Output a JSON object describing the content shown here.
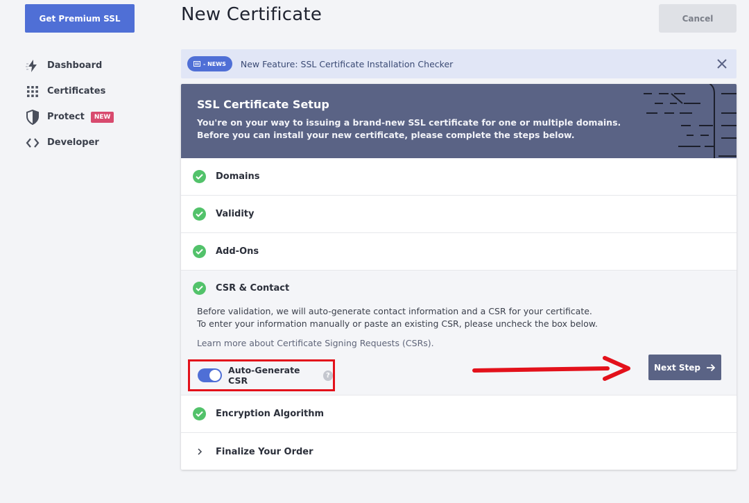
{
  "sidebar": {
    "premium_button": "Get Premium SSL",
    "items": [
      {
        "label": "Dashboard",
        "icon": "bolt-icon"
      },
      {
        "label": "Certificates",
        "icon": "grid-icon"
      },
      {
        "label": "Protect",
        "icon": "shield-icon",
        "badge": "NEW"
      },
      {
        "label": "Developer",
        "icon": "code-icon"
      }
    ]
  },
  "header": {
    "title": "New Certificate",
    "cancel_label": "Cancel"
  },
  "news": {
    "pill": "- NEWS",
    "text": "New Feature: SSL Certificate Installation Checker"
  },
  "setup": {
    "title": "SSL Certificate Setup",
    "line1": "You're on your way to issuing a brand-new SSL certificate for one or multiple domains.",
    "line2": "Before you can install your new certificate, please complete the steps below."
  },
  "steps": {
    "domains": "Domains",
    "validity": "Validity",
    "addons": "Add-Ons",
    "csr": "CSR & Contact",
    "encryption": "Encryption Algorithm",
    "finalize": "Finalize Your Order"
  },
  "csr": {
    "line1": "Before validation, we will auto-generate contact information and a CSR for your certificate.",
    "line2": "To enter your information manually or paste an existing CSR, please uncheck the box below.",
    "learn_more": "Learn more about Certificate Signing Requests (CSRs).",
    "toggle_label": "Auto-Generate CSR",
    "toggle_on": true,
    "help": "?",
    "next_label": "Next Step"
  },
  "colors": {
    "accent": "#4f6fd6",
    "header_bg": "#5a6385",
    "success": "#52c26a",
    "badge": "#d84a6e",
    "highlight": "#e3111b"
  }
}
